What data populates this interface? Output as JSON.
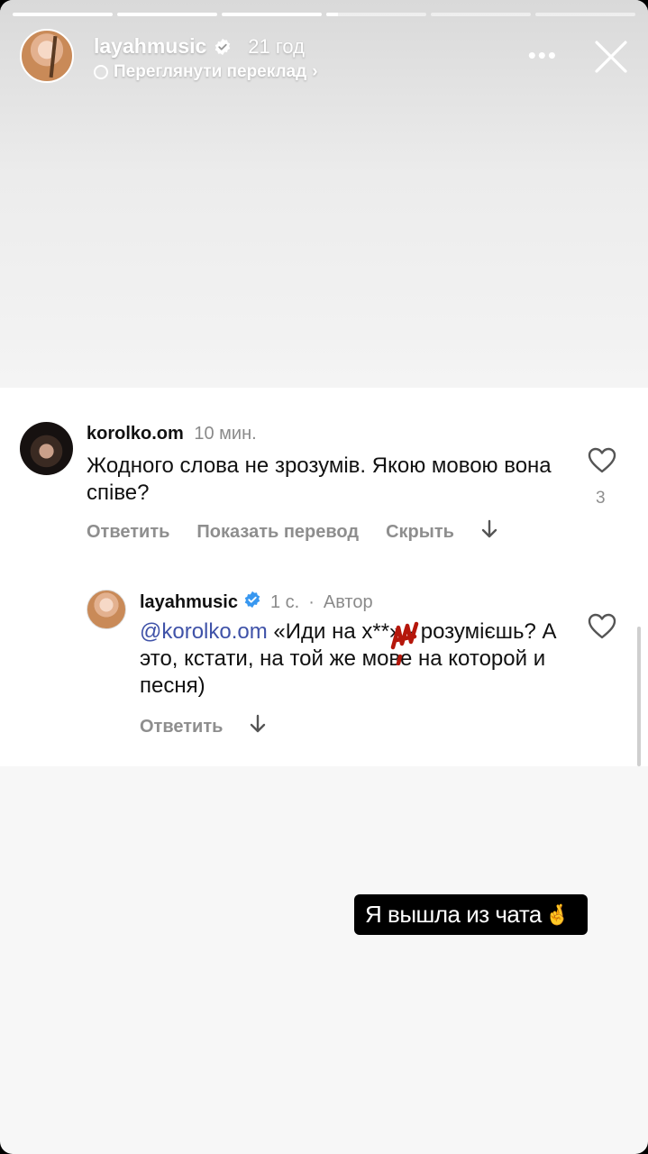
{
  "progress": [
    {
      "state": "viewed",
      "fill": 1.0
    },
    {
      "state": "viewed",
      "fill": 1.0
    },
    {
      "state": "viewed",
      "fill": 1.0
    },
    {
      "state": "current",
      "fill": 0.12
    },
    {
      "state": "unseen",
      "fill": 0.0
    },
    {
      "state": "unseen",
      "fill": 0.0
    }
  ],
  "header": {
    "username": "layahmusic",
    "time": "21 год",
    "translate_label": "Переглянути переклад",
    "more_icon": "more-horizontal-icon",
    "close_icon": "close-icon"
  },
  "comment": {
    "username": "korolko.om",
    "time": "10 мин.",
    "text": "Жодного слова не зрозумів. Якою мовою вона співе?",
    "likes": "3",
    "actions": {
      "reply": "Ответить",
      "translate": "Показать перевод",
      "hide": "Скрыть"
    }
  },
  "reply": {
    "username": "layahmusic",
    "time": "1 с.",
    "author_label": "Автор",
    "mention": "@korolko.om",
    "text": " «Иди на х**» - розумієшь? А это, кстати, на той же мове на которой и песня)",
    "actions": {
      "reply": "Ответить"
    }
  },
  "sticker": {
    "text": "Я вышла из чата",
    "emoji": "🤞"
  },
  "colors": {
    "verified": "#3797f0",
    "mention": "#3f52a8",
    "secondary_text": "#8e8e8e",
    "scribble": "#b5170b"
  }
}
